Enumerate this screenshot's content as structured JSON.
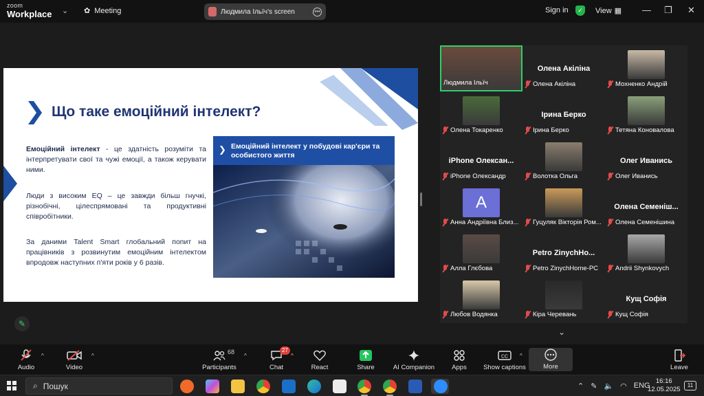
{
  "titlebar": {
    "brand_top": "zoom",
    "brand_bottom": "Workplace",
    "meeting_label": "Meeting",
    "screen_pill": "Людмила Ільїч's screen",
    "sign_in": "Sign in",
    "view_label": "View"
  },
  "slide": {
    "title": "Що таке емоційний інтелект?",
    "para1_bold": "Емоційний інтелект",
    "para1_rest": " - це здатність розуміти та інтерпретувати свої та чужі емоції, а також керувати ними.",
    "para2": "Люди з високим EQ – це завжди більш гнучкі, різнобічні, цілеспрямовані та продуктивні співробітники.",
    "para3": "За даними Talent Smart глобальний попит на працівників з розвинутим емоційним інтелектом впродовж наступних п'яти років у 6 разів.",
    "panel_title": "Емоційний інтелект  у побудові кар'єри та особистого життя"
  },
  "participants": [
    {
      "label": "Людмила Ільїч",
      "big": "",
      "kind": "photo",
      "color": "#6b4a3c",
      "active": true,
      "muted": false
    },
    {
      "label": "Олена Акіліна",
      "big": "Олена Акіліна",
      "kind": "name",
      "muted": true
    },
    {
      "label": "Мохненко Андрій",
      "big": "",
      "kind": "photo",
      "color": "#c9b9a6",
      "muted": true
    },
    {
      "label": "Олена Токаренко",
      "big": "",
      "kind": "photo",
      "color": "#4a6b3a",
      "muted": true
    },
    {
      "label": "Ірина Берко",
      "big": "Ірина Берко",
      "kind": "name",
      "muted": true
    },
    {
      "label": "Тетяна Коновалова",
      "big": "",
      "kind": "photo",
      "color": "#8aa07a",
      "muted": true
    },
    {
      "label": "iPhone Олександр",
      "big": "iPhone Олексан...",
      "kind": "name",
      "muted": true
    },
    {
      "label": "Волотка Ольга",
      "big": "",
      "kind": "photo",
      "color": "#8a7d6e",
      "muted": true
    },
    {
      "label": "Олег Иванись",
      "big": "Олег Иванись",
      "kind": "name",
      "muted": true
    },
    {
      "label": "Анна Андріївна Близ...",
      "big": "A",
      "kind": "avatar",
      "muted": true
    },
    {
      "label": "Гуцуляк Вікторія Ром...",
      "big": "",
      "kind": "photo",
      "color": "#c99a5a",
      "muted": true
    },
    {
      "label": "Олена Семенішина",
      "big": "Олена Семеніш...",
      "kind": "name",
      "muted": true
    },
    {
      "label": "Алла Глєбова",
      "big": "",
      "kind": "photo",
      "color": "#5a4b45",
      "muted": true
    },
    {
      "label": "Petro ZinychHome-PC",
      "big": "Petro ZinychHo...",
      "kind": "name",
      "muted": true
    },
    {
      "label": "Andrii Shynkovych",
      "big": "",
      "kind": "photo",
      "color": "#a8a8a8",
      "muted": true
    },
    {
      "label": "Любов Водянка",
      "big": "",
      "kind": "photo",
      "color": "#d8c8a8",
      "muted": true
    },
    {
      "label": "Кіра Черевань",
      "big": "",
      "kind": "photo",
      "color": "#2a2a2a",
      "muted": true
    },
    {
      "label": "Кущ Софія",
      "big": "Кущ Софія",
      "kind": "name",
      "muted": true
    }
  ],
  "toolbar": {
    "audio": "Audio",
    "video": "Video",
    "participants": "Participants",
    "participants_count": "68",
    "chat": "Chat",
    "chat_badge": "27",
    "react": "React",
    "share": "Share",
    "ai": "AI Companion",
    "apps": "Apps",
    "captions": "Show captions",
    "more": "More",
    "leave": "Leave"
  },
  "taskbar": {
    "search": "Пошук",
    "lang": "ENG",
    "time": "16:16",
    "date": "12.05.2025",
    "notif": "11"
  },
  "colors": {
    "accent_green": "#2fd06b",
    "slide_blue": "#1d4ea0",
    "muted_red": "#e34b4b"
  }
}
